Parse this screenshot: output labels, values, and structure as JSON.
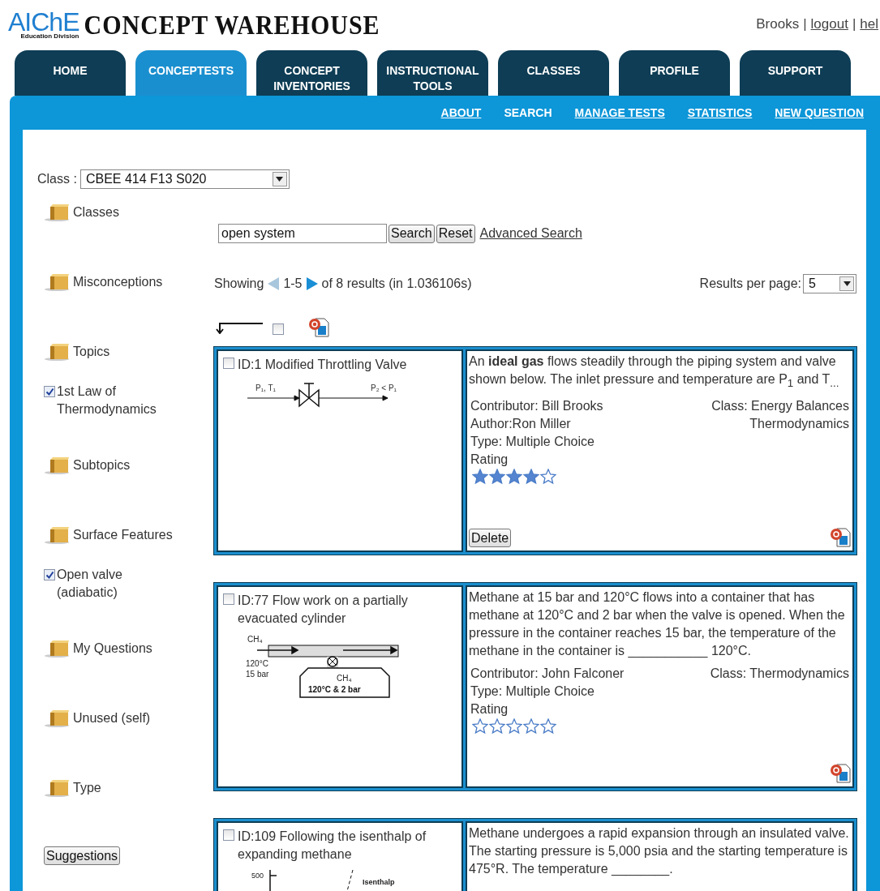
{
  "header": {
    "logo": {
      "main": "AIChE",
      "sub": "Education Division",
      "title": "CONCEPT WAREHOUSE"
    },
    "user_links": [
      {
        "label": "Brooks",
        "kind": "text"
      },
      {
        "label": "|",
        "kind": "separator"
      },
      {
        "label": "logout",
        "kind": "link"
      },
      {
        "label": "|",
        "kind": "separator"
      },
      {
        "label": "hel",
        "kind": "link"
      }
    ]
  },
  "tabs": [
    {
      "label": "HOME",
      "selected": false
    },
    {
      "label": "CONCEPTESTS",
      "selected": true
    },
    {
      "label": "CONCEPT INVENTORIES",
      "selected": false
    },
    {
      "label": "INSTRUCTIONAL TOOLS",
      "selected": false
    },
    {
      "label": "CLASSES",
      "selected": false
    },
    {
      "label": "PROFILE",
      "selected": false
    },
    {
      "label": "SUPPORT",
      "selected": false
    }
  ],
  "subnav": [
    {
      "label": "ABOUT",
      "selected": false
    },
    {
      "label": "SEARCH",
      "selected": true
    },
    {
      "label": "MANAGE TESTS",
      "selected": false
    },
    {
      "label": "STATISTICS",
      "selected": false
    },
    {
      "label": "NEW QUESTION",
      "selected": false
    }
  ],
  "class_select": {
    "label": "Class :",
    "value": "CBEE 414 F13 S020"
  },
  "sidebar": [
    {
      "kind": "folder",
      "label": "Classes"
    },
    {
      "kind": "folder",
      "label": "Misconceptions"
    },
    {
      "kind": "folder",
      "label": "Topics"
    },
    {
      "kind": "check",
      "label": "1st Law of Thermodynamics",
      "checked": true
    },
    {
      "kind": "folder",
      "label": "Subtopics"
    },
    {
      "kind": "folder",
      "label": "Surface Features"
    },
    {
      "kind": "check",
      "label": "Open valve (adiabatic)",
      "checked": true
    },
    {
      "kind": "folder",
      "label": "My Questions"
    },
    {
      "kind": "folder",
      "label": "Unused (self)"
    },
    {
      "kind": "folder",
      "label": "Type"
    }
  ],
  "suggestions_button": "Suggestions",
  "search": {
    "value": "open system",
    "buttons": [
      "Search",
      "Reset"
    ],
    "advanced_link": "Advanced Search"
  },
  "results": {
    "showing": "Showing",
    "range": "1-5",
    "summary": "of 8 results (in 1.036106s)",
    "per_page_label": "Results per page:",
    "per_page": "5"
  },
  "select_all": {
    "checked": false
  },
  "questions": [
    {
      "checked": false,
      "title": "ID:1 Modified Throttling Valve",
      "diagram": {
        "kind": "valve",
        "labels": [
          "P₁, T₁",
          "P₂ < P₁"
        ]
      },
      "text": "An **ideal gas** flows steadily through the piping system and valve shown below. The inlet pressure and temperature are P$_{1}$ and T$_{...}$",
      "meta_left": [
        "Contributor: Bill Brooks",
        "Author:Ron Miller",
        "Type: Multiple Choice",
        "Rating"
      ],
      "meta_right": [
        "Class: Energy Balances",
        "Thermodynamics"
      ],
      "stars": 4,
      "delete_button": "Delete"
    },
    {
      "checked": false,
      "title": "ID:77 Flow work on a partially evacuated cylinder",
      "diagram": {
        "kind": "tank",
        "labels": [
          "CH₄",
          "120°C",
          "15 bar",
          "CH₄",
          "120°C & 2 bar"
        ]
      },
      "text": "Methane at 15 bar and 120°C flows into a container that has methane at 120°C  and 2 bar when the valve is opened. When the pressure in the container reaches 15 bar, the temperature of the methane in the container is ___________ 120°C.",
      "meta_left": [
        "Contributor: John Falconer",
        "Type: Multiple Choice",
        "Rating"
      ],
      "meta_right": [
        "Class: Thermodynamics"
      ],
      "stars": 0
    },
    {
      "checked": false,
      "title": "ID:109 Following the isenthalp of expanding methane",
      "diagram": {
        "kind": "plot",
        "labels": [
          "500",
          "Isenthalp"
        ]
      },
      "text": "Methane undergoes a rapid expansion through an insulated valve. The starting pressure is 5,000 psia and the starting temperature is 475°R. The temperature ________."
    }
  ]
}
